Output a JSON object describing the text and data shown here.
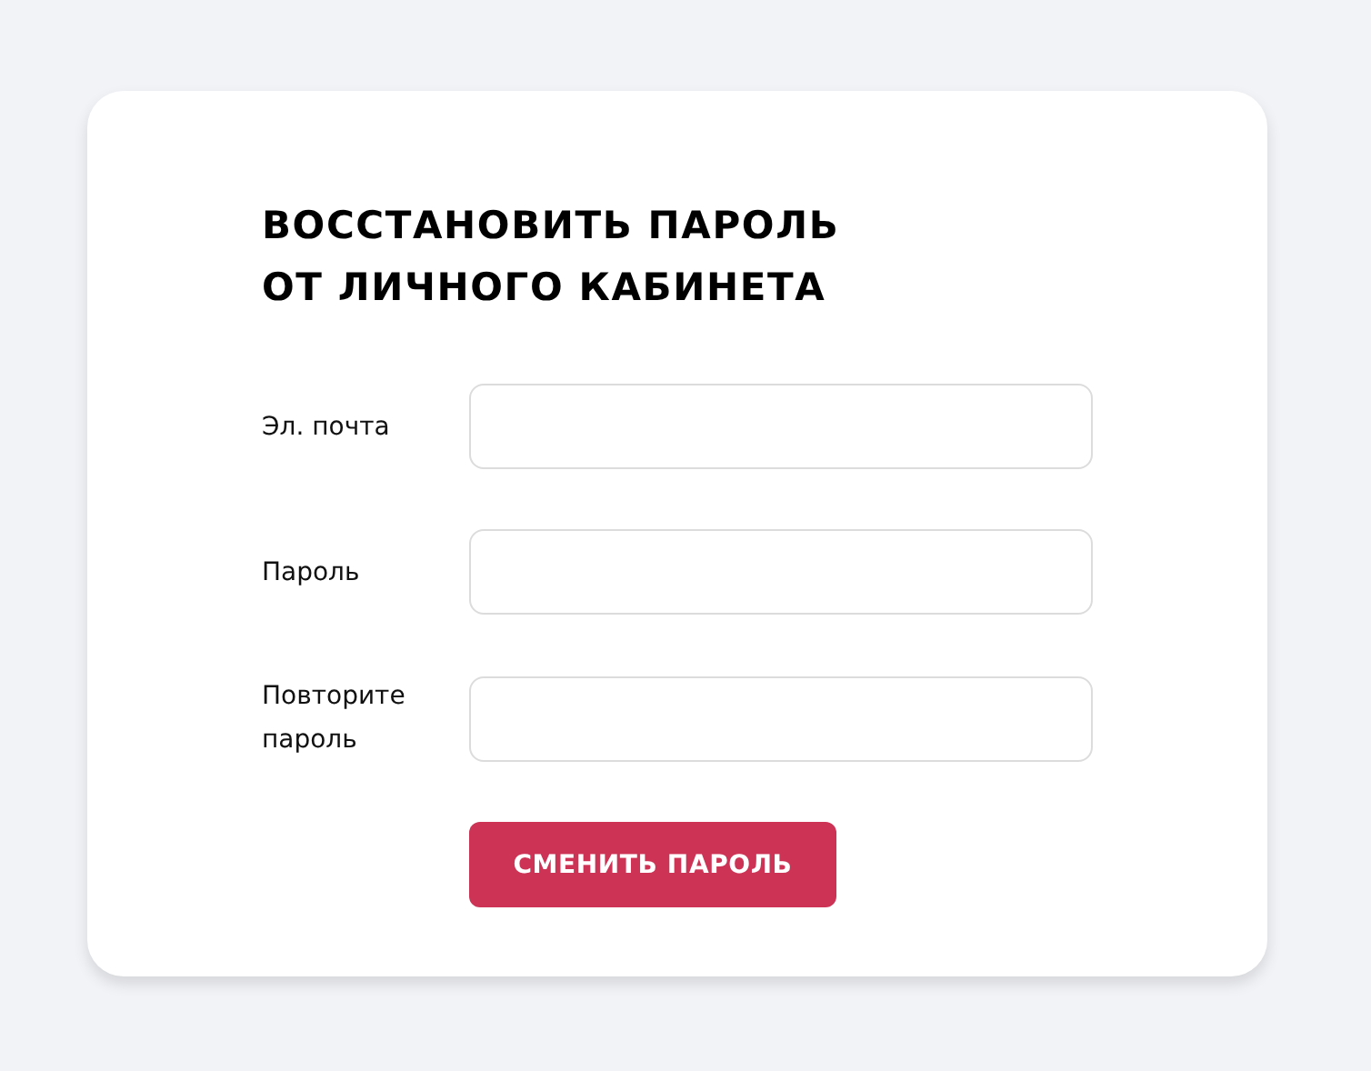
{
  "title_lines": [
    "ВОССТАНОВИТЬ ПАРОЛЬ",
    "ОТ ЛИЧНОГО КАБИНЕТА"
  ],
  "fields": [
    {
      "label": "Эл. почта"
    },
    {
      "label": "Пароль"
    },
    {
      "label": "Повторите пароль"
    }
  ],
  "submit_button": "СМЕНИТЬ ПАРОЛЬ"
}
